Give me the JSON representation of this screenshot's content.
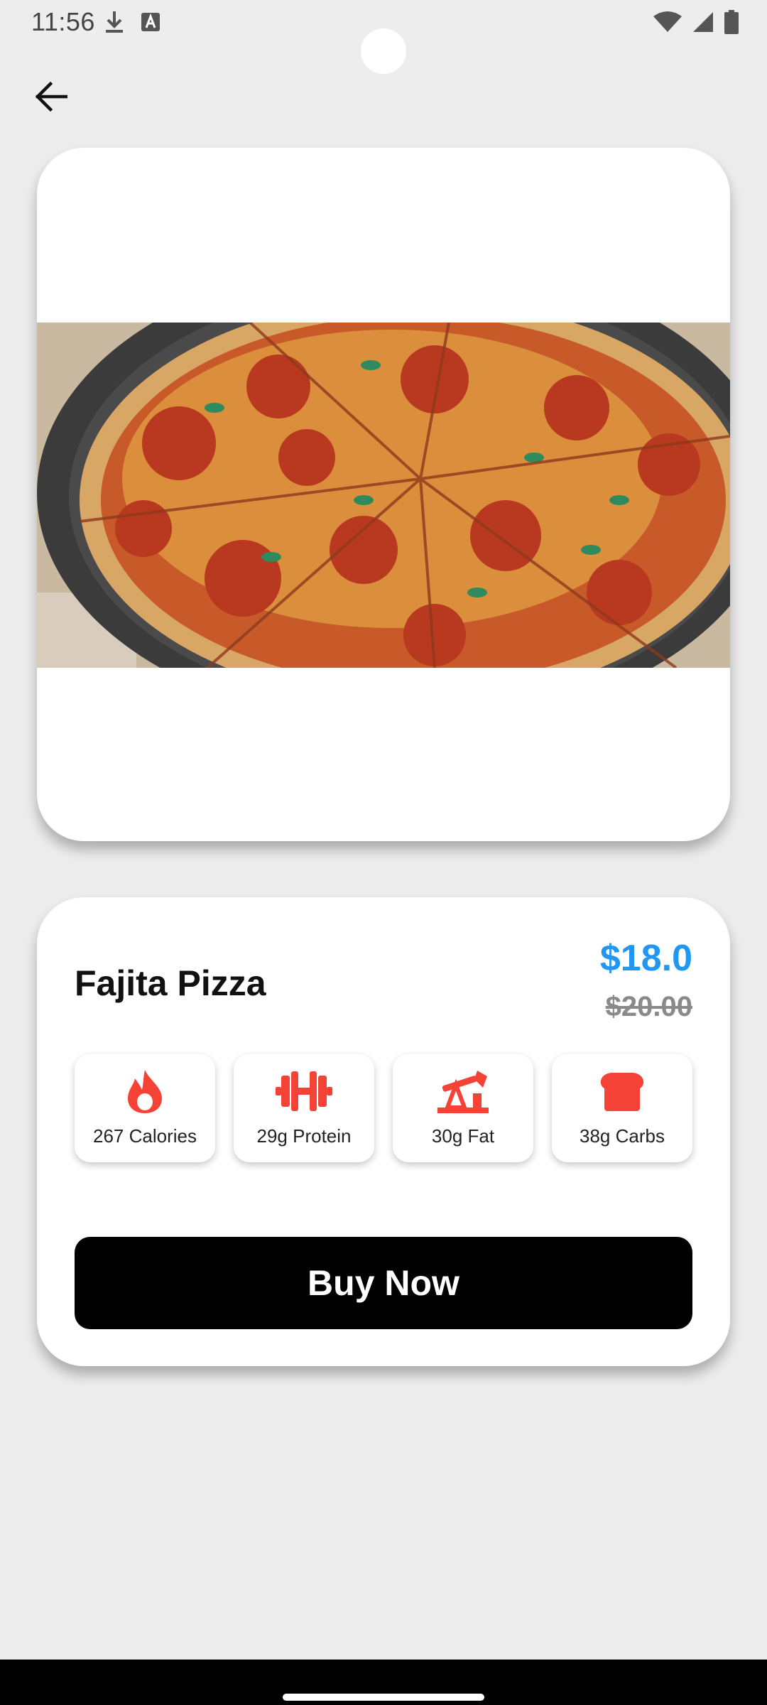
{
  "status_bar": {
    "time": "11:56",
    "left_icons": [
      "download-icon",
      "text-badge-icon"
    ],
    "right_icons": [
      "wifi-icon",
      "signal-icon",
      "battery-icon"
    ]
  },
  "header": {
    "back_icon": "arrow-left-icon"
  },
  "product": {
    "name": "Fajita Pizza",
    "price": "$18.0",
    "original_price": "$20.00",
    "image": "pepperoni-pizza-photo"
  },
  "nutrition": [
    {
      "label": "267 Calories",
      "icon": "flame-icon"
    },
    {
      "label": "29g Protein",
      "icon": "dumbbell-icon"
    },
    {
      "label": "30g Fat",
      "icon": "oil-pump-icon"
    },
    {
      "label": "38g Carbs",
      "icon": "bread-icon"
    }
  ],
  "actions": {
    "buy_label": "Buy Now"
  },
  "colors": {
    "accent_price": "#2196f3",
    "nutrition_icon": "#f44336",
    "button_bg": "#000000",
    "background": "#ededed"
  }
}
